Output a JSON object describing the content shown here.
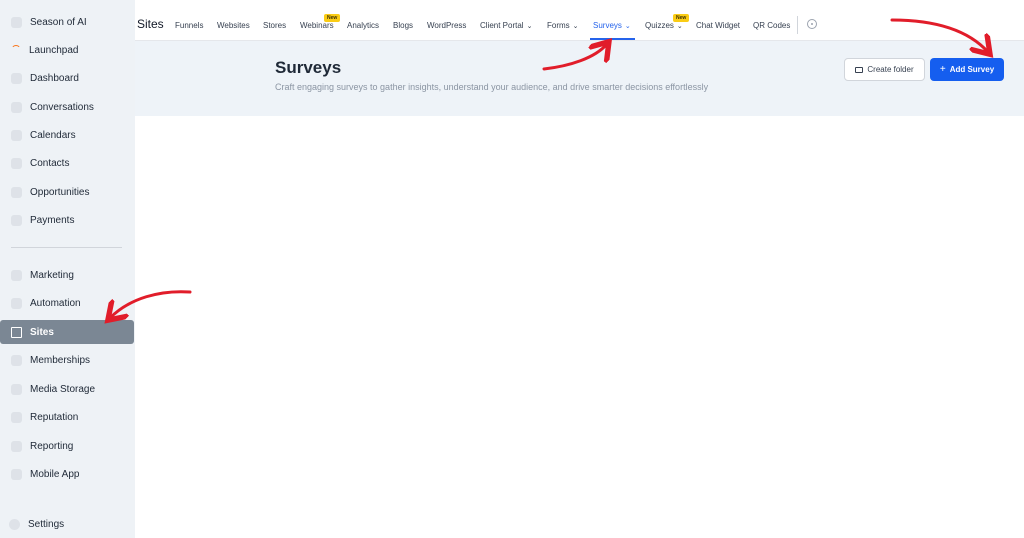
{
  "sidebar": {
    "items": [
      {
        "label": "Season of AI",
        "icon": "sparkle-icon"
      },
      {
        "label": "Launchpad",
        "icon": "launchpad-icon"
      },
      {
        "label": "Dashboard",
        "icon": "dashboard-icon"
      },
      {
        "label": "Conversations",
        "icon": "chat-icon"
      },
      {
        "label": "Calendars",
        "icon": "calendar-icon"
      },
      {
        "label": "Contacts",
        "icon": "contacts-icon"
      },
      {
        "label": "Opportunities",
        "icon": "funnel-icon"
      },
      {
        "label": "Payments",
        "icon": "payments-icon"
      },
      {
        "label": "Marketing",
        "icon": "megaphone-icon"
      },
      {
        "label": "Automation",
        "icon": "automation-icon"
      },
      {
        "label": "Sites",
        "icon": "sites-icon",
        "active": true
      },
      {
        "label": "Memberships",
        "icon": "memberships-icon"
      },
      {
        "label": "Media Storage",
        "icon": "media-icon"
      },
      {
        "label": "Reputation",
        "icon": "star-icon"
      },
      {
        "label": "Reporting",
        "icon": "chart-icon"
      },
      {
        "label": "Mobile App",
        "icon": "mobile-icon"
      },
      {
        "label": "Settings",
        "icon": "gear-icon"
      }
    ]
  },
  "topnav": {
    "brand": "Sites",
    "tabs": [
      {
        "label": "Funnels"
      },
      {
        "label": "Websites"
      },
      {
        "label": "Stores"
      },
      {
        "label": "Webinars",
        "badge": "New"
      },
      {
        "label": "Analytics"
      },
      {
        "label": "Blogs"
      },
      {
        "label": "WordPress"
      },
      {
        "label": "Client Portal",
        "dropdown": true
      },
      {
        "label": "Forms",
        "dropdown": true
      },
      {
        "label": "Surveys",
        "dropdown": true,
        "active": true
      },
      {
        "label": "Quizzes",
        "dropdown": true,
        "badge": "New"
      },
      {
        "label": "Chat Widget"
      },
      {
        "label": "QR Codes"
      }
    ]
  },
  "page": {
    "title": "Surveys",
    "description": "Craft engaging surveys to gather insights, understand your audience, and drive smarter decisions effortlessly",
    "create_folder_label": "Create folder",
    "add_survey_label": "Add Survey",
    "add_survey_icon": "+"
  },
  "colors": {
    "accent": "#155eef",
    "active_tab": "#2563eb",
    "sidebar_bg": "#eef2f6",
    "sidebar_active": "#7b8794",
    "badge": "#facc15",
    "annotation_arrow": "#e11d2a"
  }
}
